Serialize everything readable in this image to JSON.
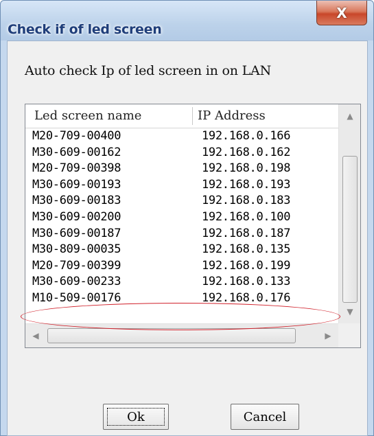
{
  "window": {
    "title": "Check if of led screen",
    "close_glyph": "X"
  },
  "description": "Auto check Ip of led screen in on LAN",
  "table": {
    "columns": [
      "Led screen name",
      "IP Address"
    ],
    "rows": [
      [
        "M20-709-00400",
        "192.168.0.166"
      ],
      [
        "M30-609-00162",
        "192.168.0.162"
      ],
      [
        "M20-709-00398",
        "192.168.0.198"
      ],
      [
        "M30-609-00193",
        "192.168.0.193"
      ],
      [
        "M30-609-00183",
        "192.168.0.183"
      ],
      [
        "M30-609-00200",
        "192.168.0.100"
      ],
      [
        "M30-609-00187",
        "192.168.0.187"
      ],
      [
        "M30-809-00035",
        "192.168.0.135"
      ],
      [
        "M20-709-00399",
        "192.168.0.199"
      ],
      [
        "M30-609-00233",
        "192.168.0.133"
      ],
      [
        "M10-509-00176",
        "192.168.0.176"
      ]
    ]
  },
  "scrollbar": {
    "up_icon": "▲",
    "down_icon": "▼",
    "left_icon": "◀",
    "right_icon": "▶"
  },
  "buttons": {
    "ok": "Ok",
    "cancel": "Cancel"
  },
  "colors": {
    "highlight_oval": "#d0202a",
    "title_text": "#1f3e7a"
  }
}
